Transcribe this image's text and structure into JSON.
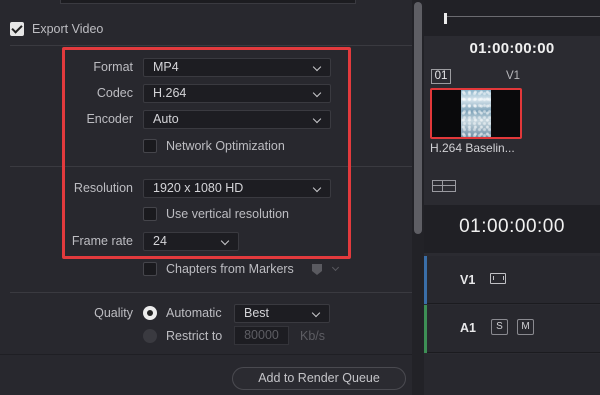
{
  "export_video": {
    "label": "Export Video",
    "checked": true
  },
  "video": {
    "format": {
      "label": "Format",
      "value": "MP4"
    },
    "codec": {
      "label": "Codec",
      "value": "H.264"
    },
    "encoder": {
      "label": "Encoder",
      "value": "Auto"
    },
    "network_optimization": {
      "label": "Network Optimization",
      "checked": false
    },
    "resolution": {
      "label": "Resolution",
      "value": "1920 x 1080 HD"
    },
    "vertical_resolution": {
      "label": "Use vertical resolution",
      "checked": false
    },
    "frame_rate": {
      "label": "Frame rate",
      "value": "24"
    },
    "chapters_from_markers": {
      "label": "Chapters from Markers",
      "checked": false
    }
  },
  "quality": {
    "label": "Quality",
    "automatic": {
      "label": "Automatic",
      "selected": true,
      "value": "Best"
    },
    "restrict_to": {
      "label": "Restrict to",
      "selected": false,
      "value": "80000",
      "unit": "Kb/s"
    }
  },
  "render_queue_button": "Add to Render Queue",
  "timeline": {
    "top_timecode": "01:00:00:00",
    "clip": {
      "number": "01",
      "track": "V1",
      "name": "H.264 Baselin..."
    },
    "big_timecode": "01:00:00:00",
    "tracks": [
      {
        "label": "V1",
        "color": "#3a6ea8"
      },
      {
        "label": "A1",
        "color": "#3d8f55",
        "buttons": [
          "S",
          "M"
        ]
      }
    ]
  },
  "colors": {
    "highlight": "#e23a3d",
    "panel_bg": "#28282e"
  }
}
